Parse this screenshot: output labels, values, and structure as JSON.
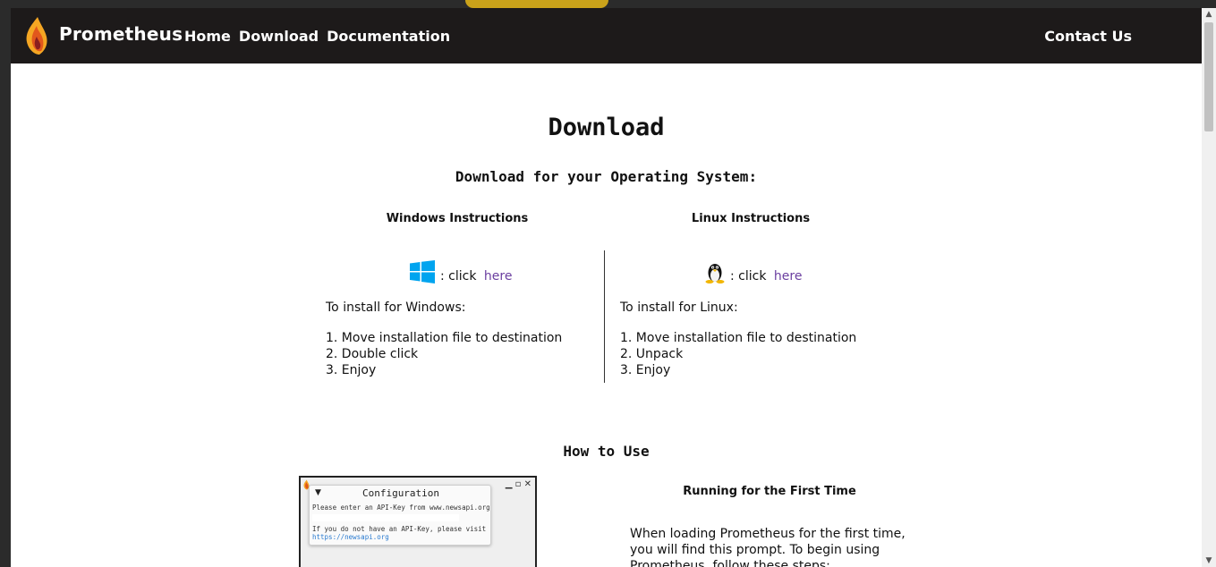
{
  "navbar": {
    "brand": "Prometheus",
    "links": [
      "Home",
      "Download",
      "Documentation"
    ],
    "contact": "Contact Us"
  },
  "page": {
    "title": "Download",
    "subtitle": "Download for your Operating System:"
  },
  "windows": {
    "heading": "Windows Instructions",
    "click_prefix": ": click",
    "link_text": "here",
    "intro": "To install for Windows:",
    "steps": [
      "1. Move installation file to destination",
      "2. Double click",
      "3. Enjoy"
    ]
  },
  "linux": {
    "heading": "Linux Instructions",
    "click_prefix": ": click",
    "link_text": "here",
    "intro": "To install for Linux:",
    "steps": [
      "1. Move installation file to destination",
      "2. Unpack",
      "3. Enjoy"
    ]
  },
  "howto": {
    "heading": "How to Use",
    "running_heading": "Running for the First Time",
    "running_text": [
      "When loading Prometheus for the first time,",
      "you will find this prompt.  To begin using",
      "Prometheus, follow these steps:"
    ]
  },
  "config_dialog": {
    "title": "Configuration",
    "line1": "Please enter an API-Key from www.newsapi.org",
    "line2": "If you do not have an API-Key, please visit",
    "link": "https://newsapi.org",
    "window_buttons": "▁ ▫ ✕"
  },
  "colors": {
    "navbar_bg": "#1d1a1a",
    "link": "#6b3fa0",
    "windows_blue": "#00a4ef"
  },
  "icons": [
    "flame-logo-icon",
    "windows-logo-icon",
    "linux-tux-icon"
  ]
}
